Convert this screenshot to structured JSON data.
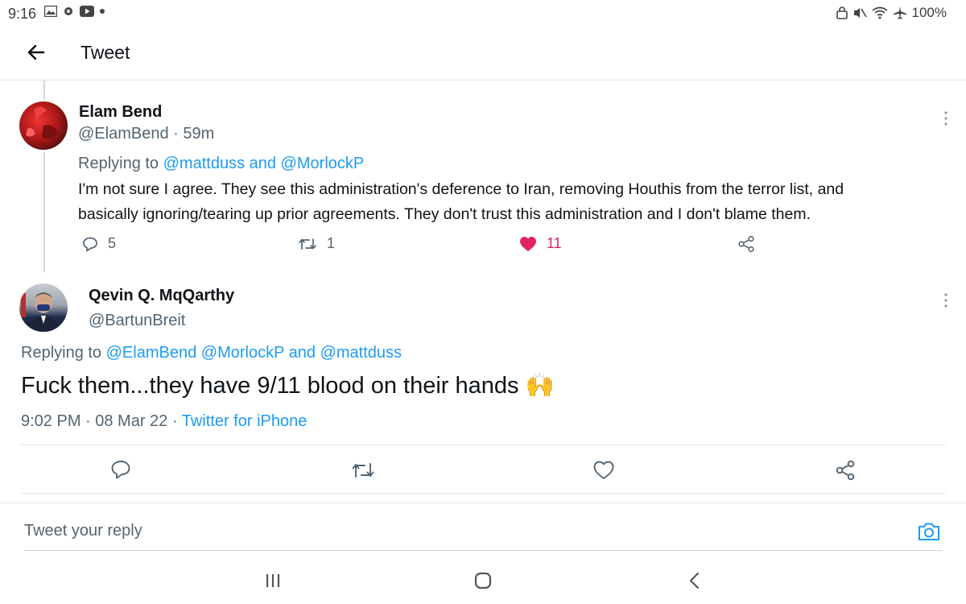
{
  "status_bar": {
    "time": "9:16",
    "battery": "100%",
    "icons_left": [
      "image-icon",
      "gear-icon",
      "youtube-icon",
      "dot-icon"
    ],
    "icons_right": [
      "lock-icon",
      "mute-icon",
      "wifi-icon",
      "airplane-icon"
    ]
  },
  "header": {
    "title": "Tweet"
  },
  "parent_tweet": {
    "name": "Elam Bend",
    "handle": "@ElamBend · 59m",
    "replying_prefix": "Replying to",
    "replying_user_1": "@mattduss",
    "replying_and": "and",
    "replying_user_2": "@MorlockP",
    "text_line_1": "I'm not sure I agree. They see this administration's deference to Iran, removing Houthis from the terror list, and",
    "text_line_2": "basically ignoring/tearing up prior agreements. They don't trust this administration and I don't blame them.",
    "reply_count": "5",
    "retweet_count": "1",
    "like_count": "11"
  },
  "main_tweet": {
    "name": "Qevin Q. MqQarthy",
    "handle": "@BartunBreit",
    "replying_prefix": "Replying to",
    "replying_users": "@ElamBend @MorlockP",
    "replying_and": "and",
    "replying_user_last": "@mattduss",
    "text": "Fuck them...they have 9/11 blood on their hands",
    "emoji": "🙌",
    "timestamp": "9:02 PM · 08 Mar 22 · ",
    "source": "Twitter for iPhone"
  },
  "reply_bar": {
    "placeholder": "Tweet your reply"
  },
  "colors": {
    "link": "#1d9bf0",
    "like": "#e0245e",
    "muted": "#536471",
    "text": "#0f1419"
  }
}
